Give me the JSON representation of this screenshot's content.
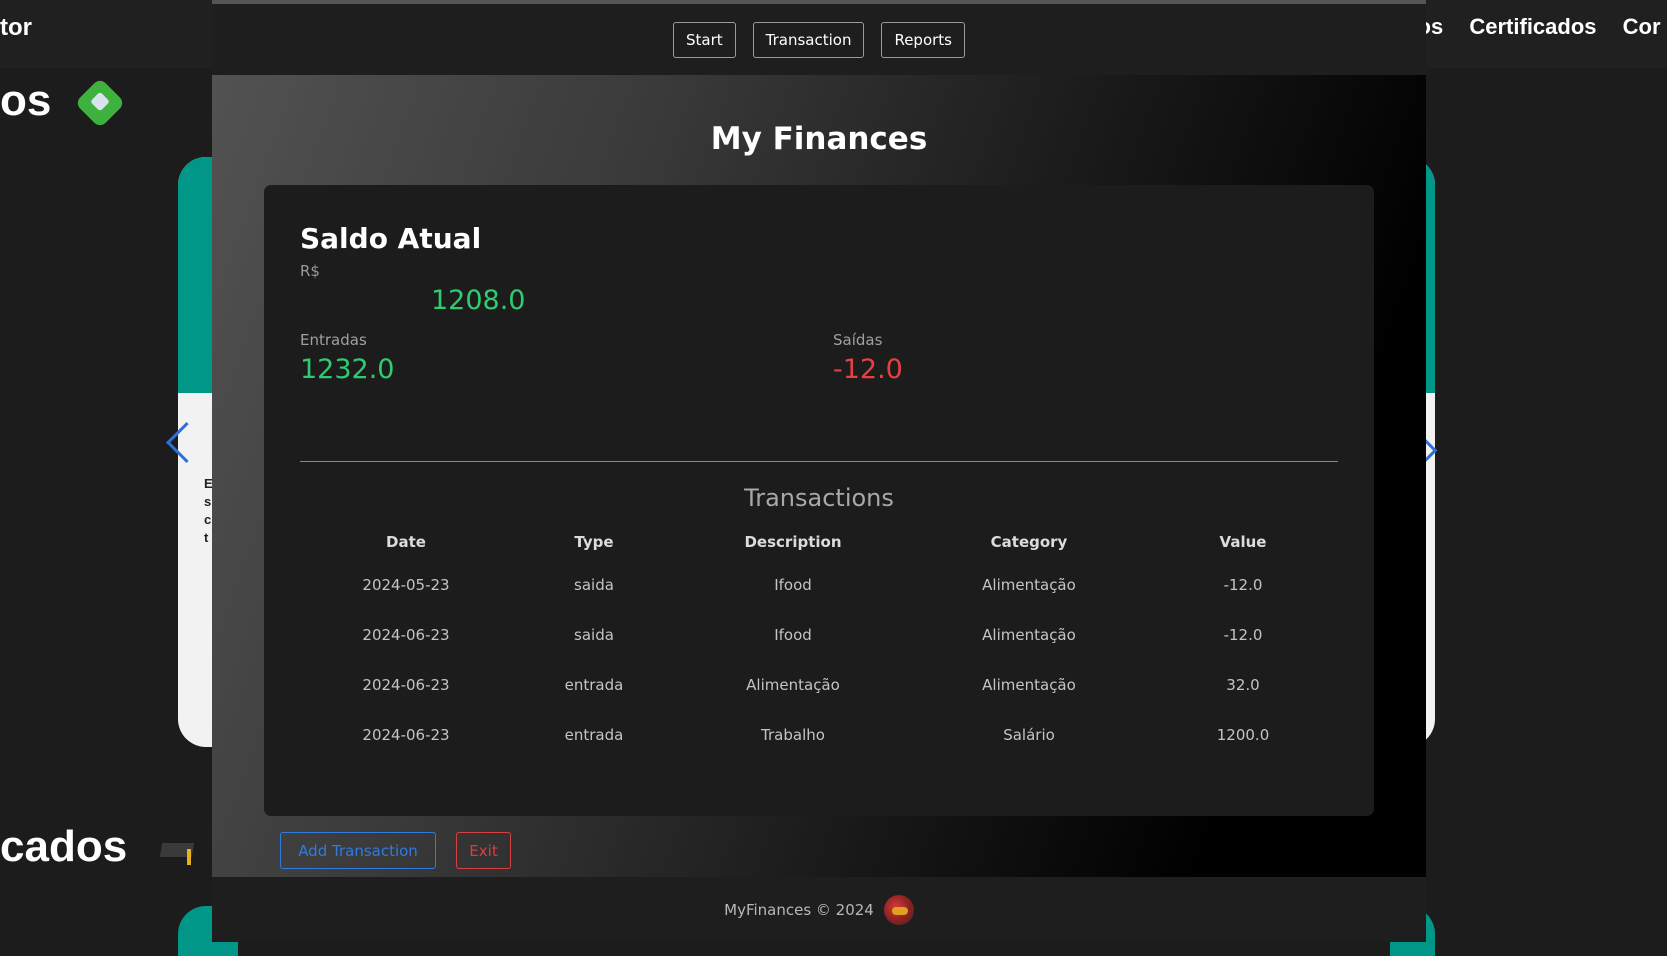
{
  "background_page": {
    "logo_fragment": "tor",
    "nav_items": [
      "etos",
      "Certificados",
      "Cor"
    ],
    "heading_projects_fragment": "os",
    "heading_certificates_fragment": "cados",
    "card_text_fragment": "E s c t"
  },
  "app": {
    "nav": {
      "start": "Start",
      "transaction": "Transaction",
      "reports": "Reports"
    },
    "title": "My Finances",
    "balance": {
      "title": "Saldo Atual",
      "currency": "R$",
      "amount": "1208.0",
      "income_label": "Entradas",
      "income_value": "1232.0",
      "expense_label": "Saídas",
      "expense_value": "-12.0"
    },
    "transactions": {
      "title": "Transactions",
      "headers": [
        "Date",
        "Type",
        "Description",
        "Category",
        "Value"
      ],
      "rows": [
        [
          "2024-05-23",
          "saida",
          "Ifood",
          "Alimentação",
          "-12.0"
        ],
        [
          "2024-06-23",
          "saida",
          "Ifood",
          "Alimentação",
          "-12.0"
        ],
        [
          "2024-06-23",
          "entrada",
          "Alimentação",
          "Alimentação",
          "32.0"
        ],
        [
          "2024-06-23",
          "entrada",
          "Trabalho",
          "Salário",
          "1200.0"
        ]
      ]
    },
    "actions": {
      "add": "Add Transaction",
      "exit": "Exit"
    },
    "footer": "MyFinances © 2024"
  },
  "colors": {
    "positive": "#2ecc71",
    "negative": "#e84040",
    "primary_button": "#2f7be0",
    "danger_button": "#d64040",
    "teal_card": "#009688"
  }
}
